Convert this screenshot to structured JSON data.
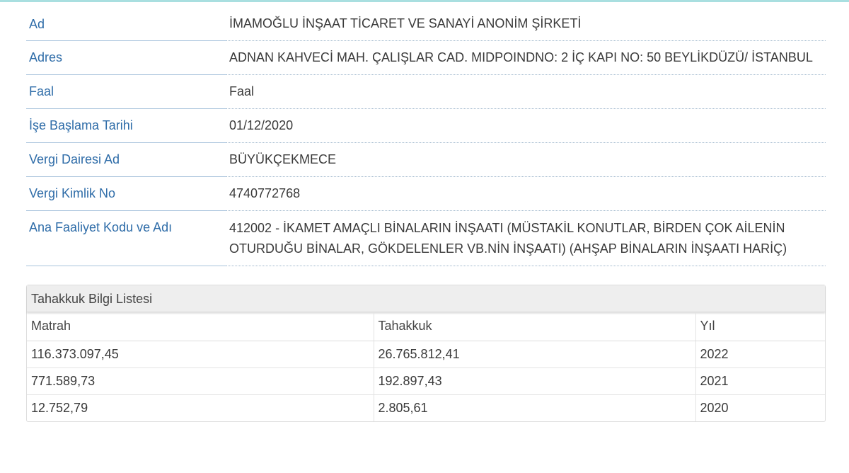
{
  "company_info": {
    "rows": [
      {
        "label": "Ad",
        "value": "İMAMOĞLU İNŞAAT TİCARET VE SANAYİ ANONİM ŞİRKETİ"
      },
      {
        "label": "Adres",
        "value": "ADNAN KAHVECİ MAH. ÇALIŞLAR CAD. MIDPOINDNO: 2 İÇ KAPI NO: 50 BEYLİKDÜZÜ/ İSTANBUL"
      },
      {
        "label": "Faal",
        "value": "Faal"
      },
      {
        "label": "İşe Başlama Tarihi",
        "value": "01/12/2020"
      },
      {
        "label": "Vergi Dairesi Ad",
        "value": "BÜYÜKÇEKMECE"
      },
      {
        "label": "Vergi Kimlik No",
        "value": "4740772768"
      },
      {
        "label": "Ana Faaliyet Kodu ve Adı",
        "value": "412002 - İKAMET AMAÇLI BİNALARIN İNŞAATI (MÜSTAKİL KONUTLAR, BİRDEN ÇOK AİLENİN OTURDUĞU BİNALAR, GÖKDELENLER VB.NİN İNŞAATI) (AHŞAP BİNALARIN İNŞAATI HARİÇ)"
      }
    ]
  },
  "tahakkuk_panel": {
    "title": "Tahakkuk Bilgi Listesi",
    "columns": [
      "Matrah",
      "Tahakkuk",
      "Yıl"
    ],
    "rows": [
      [
        "116.373.097,45",
        "26.765.812,41",
        "2022"
      ],
      [
        "771.589,73",
        "192.897,43",
        "2021"
      ],
      [
        "12.752,79",
        "2.805,61",
        "2020"
      ]
    ]
  },
  "colors": {
    "label": "#2e6ca8",
    "top_strip": "#a9dfe0",
    "panel_heading_bg": "#eeeeee"
  }
}
